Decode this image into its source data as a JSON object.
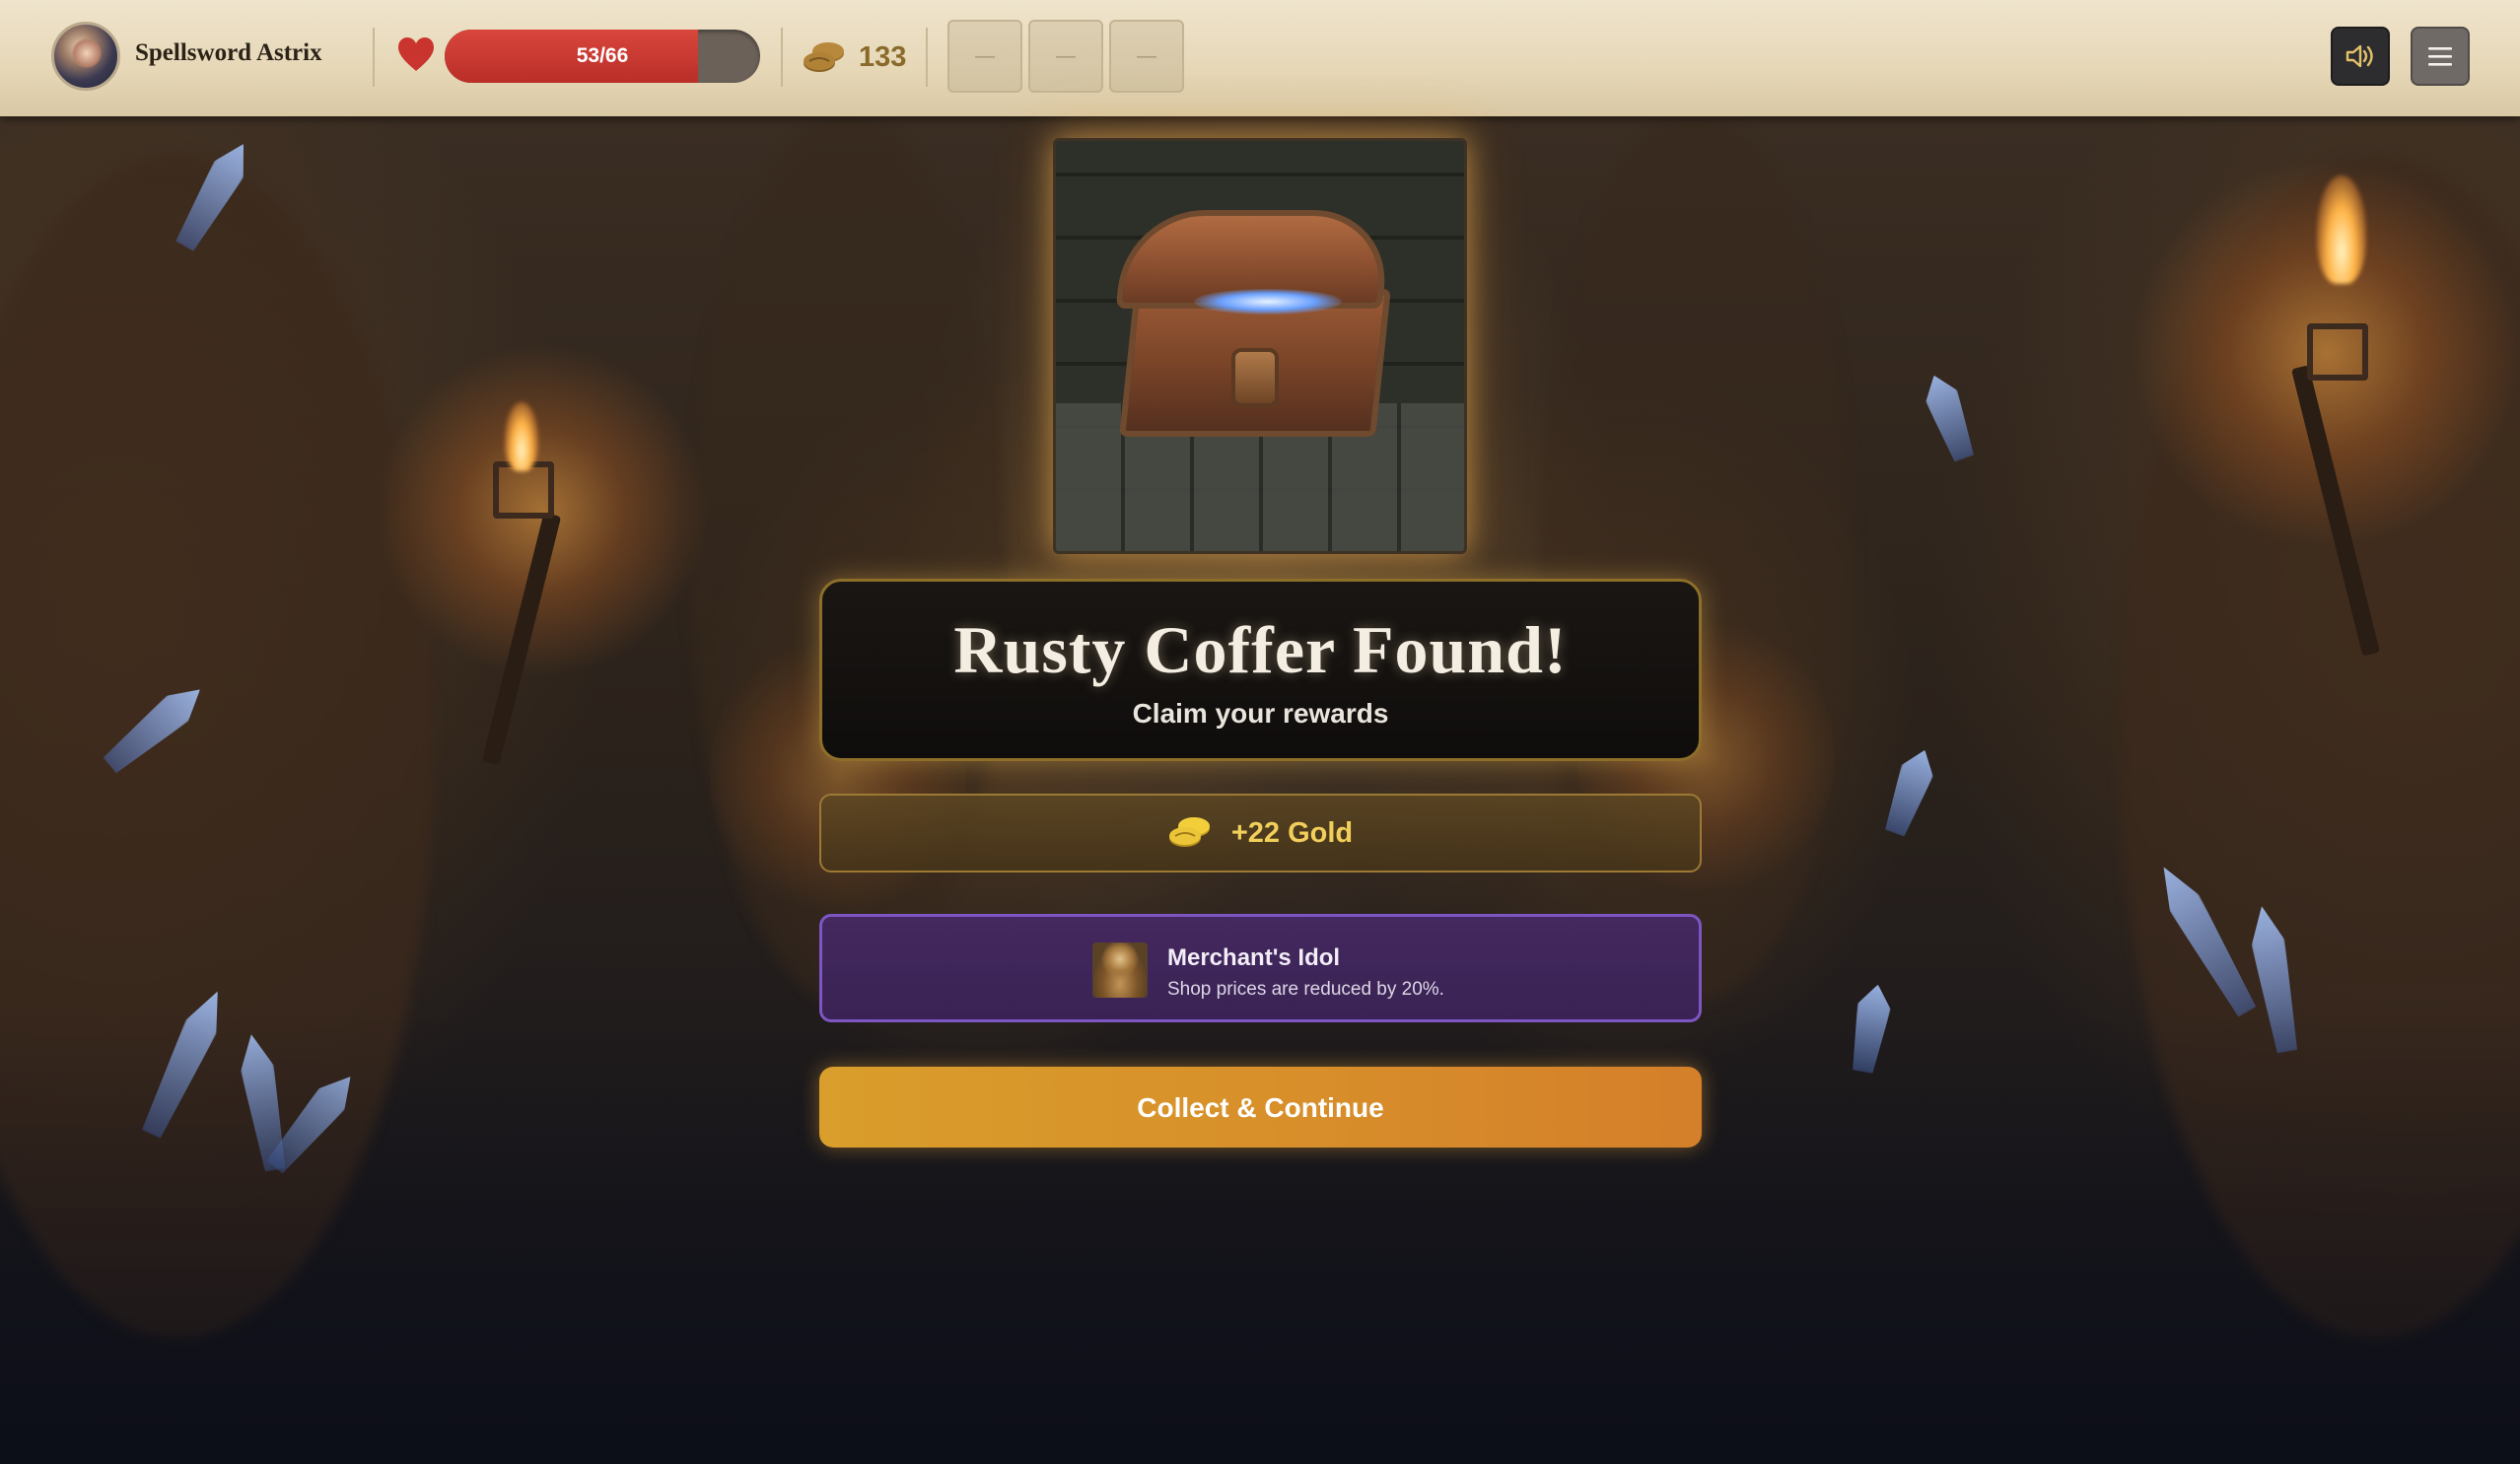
{
  "player": {
    "name": "Spellsword Astrix"
  },
  "health": {
    "text": "53/66",
    "current": 53,
    "max": 66
  },
  "gold": {
    "count": "133"
  },
  "slots": [
    {
      "label": "—"
    },
    {
      "label": "—"
    },
    {
      "label": "—"
    }
  ],
  "event": {
    "title": "Rusty Coffer Found!",
    "subtitle": "Claim your rewards",
    "gold_reward": "+22 Gold",
    "relic": {
      "name": "Merchant's Idol",
      "description": "Shop prices are reduced by 20%."
    },
    "continue_label": "Collect & Continue"
  },
  "icons": {
    "heart": "heart-icon",
    "coins": "coins-icon",
    "sound": "speaker-icon",
    "menu": "hamburger-menu-icon"
  },
  "colors": {
    "health": "#c9352e",
    "gold_text": "#f2cf5a",
    "relic_border": "#7e56c4",
    "continue_button": "#d8902a"
  }
}
